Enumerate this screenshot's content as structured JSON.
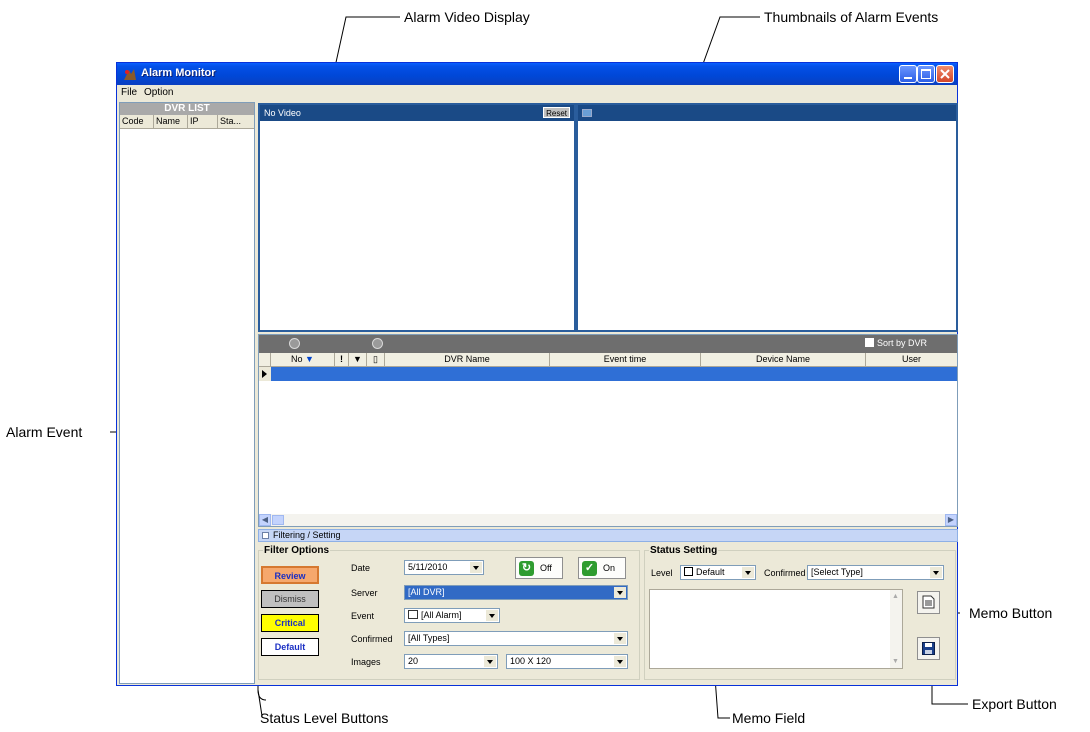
{
  "callouts": {
    "alarm_video_display": "Alarm Video Display",
    "thumbnails": "Thumbnails of Alarm Events",
    "alarm_event": "Alarm Event",
    "memo_button": "Memo Button",
    "export_button": "Export Button",
    "memo_field": "Memo Field",
    "status_level_buttons": "Status Level Buttons"
  },
  "window": {
    "title": "Alarm Monitor",
    "menu": [
      "File",
      "Option"
    ]
  },
  "dvr_list": {
    "header": "DVR LIST",
    "columns": [
      "Code",
      "Name",
      "IP",
      "Sta..."
    ]
  },
  "video": {
    "status": "No Video",
    "reset_label": "Reset"
  },
  "events": {
    "sort_by_dvr": "Sort by DVR",
    "columns": [
      "No",
      "!",
      "T",
      "",
      "DVR Name",
      "Event time",
      "Device Name",
      "User"
    ]
  },
  "filter_bar": {
    "label": "Filtering / Setting"
  },
  "filter_options": {
    "title": "Filter Options",
    "levels": [
      "Review",
      "Dismiss",
      "Critical",
      "Default"
    ],
    "date_label": "Date",
    "date_value": "5/11/2010",
    "off_label": "Off",
    "on_label": "On",
    "server_label": "Server",
    "server_value": "[All DVR]",
    "event_label": "Event",
    "event_value": "[All Alarm]",
    "confirmed_label": "Confirmed",
    "confirmed_value": "[All Types]",
    "images_label": "Images",
    "images_value": "20",
    "size_value": "100 X 120"
  },
  "status_setting": {
    "title": "Status Setting",
    "level_label": "Level",
    "level_value": "Default",
    "confirmed_label": "Confirmed",
    "confirmed_value": "[Select Type]"
  },
  "colors": {
    "title_bar": "#0047d6",
    "pane_header": "#1a4a86",
    "selected_row": "#2f6fd6",
    "review": "#f6a86d",
    "dismiss": "#c0c0c0",
    "critical": "#ffff00",
    "default": "#ffffff"
  }
}
